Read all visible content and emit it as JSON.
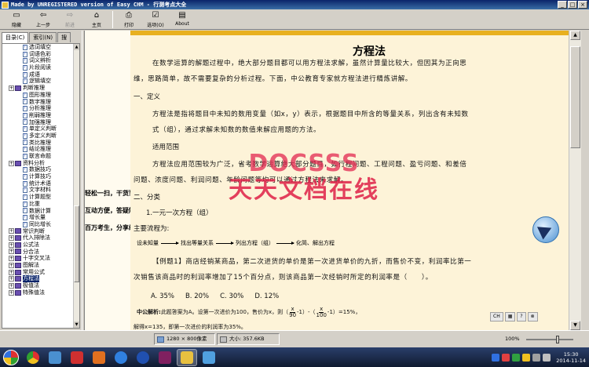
{
  "window": {
    "title": "Made by UNREGISTERED version of Easy CHM - 行测考点大全",
    "buttons": [
      "_",
      "□",
      "×"
    ]
  },
  "toolbar": {
    "buttons": [
      {
        "label": "隐藏",
        "icon": "hide-icon"
      },
      {
        "label": "上一步",
        "icon": "back-icon"
      },
      {
        "label": "前进",
        "icon": "forward-icon"
      },
      {
        "label": "主页",
        "icon": "home-icon"
      },
      {
        "label": "打印",
        "icon": "print-icon"
      },
      {
        "label": "选项(O)",
        "icon": "options-icon"
      },
      {
        "label": "About",
        "icon": "about-icon"
      }
    ]
  },
  "nav": {
    "tabs": [
      "目录(C)",
      "索引(N)",
      "搜"
    ],
    "tree": [
      {
        "label": "选词填空",
        "level": 2
      },
      {
        "label": "词语色彩",
        "level": 2
      },
      {
        "label": "词义辨析",
        "level": 2
      },
      {
        "label": "片段阅读",
        "level": 2
      },
      {
        "label": "成语",
        "level": 2
      },
      {
        "label": "逻辑填空",
        "level": 2
      },
      {
        "label": "判断推理",
        "level": 1
      },
      {
        "label": "图形推理",
        "level": 2
      },
      {
        "label": "数字推理",
        "level": 2
      },
      {
        "label": "分析推理",
        "level": 2
      },
      {
        "label": "削弱推理",
        "level": 2
      },
      {
        "label": "加强推理",
        "level": 2
      },
      {
        "label": "单定义判断",
        "level": 2
      },
      {
        "label": "多定义判断",
        "level": 2
      },
      {
        "label": "类比推理",
        "level": 2
      },
      {
        "label": "结论推理",
        "level": 2
      },
      {
        "label": "联言命题",
        "level": 2
      },
      {
        "label": "资料分析",
        "level": 1
      },
      {
        "label": "数据技巧",
        "level": 2
      },
      {
        "label": "计算技巧",
        "level": 2
      },
      {
        "label": "统计术语",
        "level": 2
      },
      {
        "label": "文字材料",
        "level": 2
      },
      {
        "label": "计算题型",
        "level": 2
      },
      {
        "label": "比重",
        "level": 2
      },
      {
        "label": "数据计算",
        "level": 2
      },
      {
        "label": "增长量",
        "level": 2
      },
      {
        "label": "同比增长",
        "level": 2
      },
      {
        "label": "常识判断",
        "level": 1
      },
      {
        "label": "代入排除法",
        "level": 1
      },
      {
        "label": "公式法",
        "level": 1
      },
      {
        "label": "分合法",
        "level": 1
      },
      {
        "label": "十字交叉法",
        "level": 1
      },
      {
        "label": "图解法",
        "level": 1
      },
      {
        "label": "常用公式",
        "level": 1
      },
      {
        "label": "方程法",
        "level": 1,
        "selected": true
      },
      {
        "label": "极值法",
        "level": 1
      },
      {
        "label": "特殊值法",
        "level": 1
      }
    ]
  },
  "doc": {
    "title": "方程法",
    "para1_l1": "在数学运算的解题过程中，绝大部分题目都可以用方程法求解，虽然计算量比较大，但因其为正向思",
    "para1_l2": "维，思路简单，故不需要复杂的分析过程。下面，中公教育专家就方程法进行精炼讲解。",
    "sec1": "一、定义",
    "def_l1": "方程法是指将题目中未知的数用变量（如x，y）表示，根据题目中所含的等量关系，列出含有未知数",
    "def_l2": "式（组），通过求解未知数的数值来解应用题的方法。",
    "scope_title": "适用范围",
    "scope_l1": "方程法应用范围较为广泛，省考数学运算绝大部分题目，如行程问题、工程问题、盈亏问题、和差倍",
    "scope_l2": "问题、浓度问题、利润问题、年龄问题等均可以通过方程法来求解。",
    "sec2": "二、分类",
    "sub1": "1.一元一次方程（组）",
    "flow_title": "主要流程为:",
    "flow_steps": [
      "设未知量",
      "找出等量关系",
      "列出方程（组）",
      "化简、解出方程"
    ],
    "ex1_l1": "【例题1】商店经销某商品，第二次进货的单价是第一次进货单价的九折，而售价不变，利润率比第一",
    "ex1_l2": "次销售该商品时的利润率增加了15个百分点，则该商品第一次经销时所定的利润率是（　　）。",
    "options": [
      "A. 35%",
      "B. 20%",
      "C. 30%",
      "D. 12%"
    ],
    "answer_label": "中公解析:",
    "answer_text_a": "此题答案为A。设第一次进价为100，售价为x，则（",
    "answer_text_b": "-1）-（",
    "answer_text_c": "-1）=15%，",
    "frac1": {
      "num": "x",
      "den": "90"
    },
    "frac2": {
      "num": "x",
      "den": "100"
    },
    "solve_line": "解得x=135，即第一次进价的利润率为35%。",
    "overlap_lines": [
      "轻松一扫，干货到手",
      "互动方便，答疑解惑",
      "百万考生，分享经验"
    ]
  },
  "watermark": {
    "top": "DOCSSS",
    "bottom": "天天文档在线"
  },
  "ime": [
    "CH",
    "▦",
    "?",
    "⊗"
  ],
  "status": {
    "dimensions": "1280 × 800像素",
    "size": "大小: 357.6KB",
    "zoom": "100%"
  },
  "clock": {
    "time": "15:30",
    "date": "2014-11-14"
  }
}
